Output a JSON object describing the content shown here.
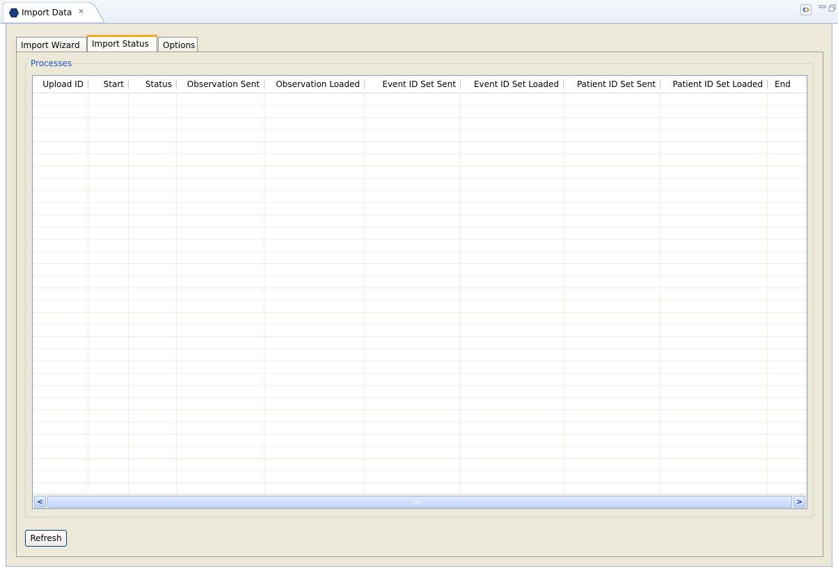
{
  "window": {
    "title": "Import Data",
    "close_glyph": "✕",
    "icons": [
      "hexagon-view-icon",
      "link-icon",
      "minimize-icon",
      "maximize-icon"
    ]
  },
  "tabs": [
    {
      "label": "Import Wizard",
      "active": false
    },
    {
      "label": "Import Status",
      "active": true
    },
    {
      "label": "Options",
      "active": false
    }
  ],
  "processes": {
    "title": "Processes",
    "columns": [
      "Upload ID",
      "Start",
      "Status",
      "Observation Sent",
      "Observation Loaded",
      "Event ID Set Sent",
      "Event ID Set Loaded",
      "Patient ID Set Sent",
      "Patient ID Set Loaded",
      "End"
    ],
    "rows": []
  },
  "scrollbar": {
    "left_glyph": "<",
    "right_glyph": ">"
  },
  "buttons": {
    "refresh": "Refresh"
  },
  "colors": {
    "accent_tab": "#f6a623",
    "group_title": "#1f4fbf",
    "panel_bg": "#ece9d8",
    "scrollbar": "#c6d8fb"
  }
}
